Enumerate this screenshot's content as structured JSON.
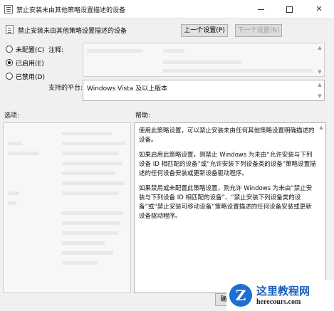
{
  "window": {
    "title": "禁止安装未由其他策略设置描述的设备",
    "minimize_icon": "minimize-icon",
    "maximize_icon": "maximize-icon",
    "close_icon": "close-icon",
    "close_glyph": "✕"
  },
  "header": {
    "policy_title": "禁止安装未由其他策略设置描述的设备",
    "prev_button": "上一个设置(P)",
    "next_button": "下一个设置(N)"
  },
  "state_options": [
    {
      "label": "未配置(C)",
      "checked": false
    },
    {
      "label": "已启用(E)",
      "checked": true
    },
    {
      "label": "已禁用(D)",
      "checked": false
    }
  ],
  "labels": {
    "comment": "注释:",
    "supported_on": "支持的平台:",
    "options": "选项:",
    "help": "帮助:"
  },
  "supported_platform": "Windows Vista 及以上版本",
  "help_paragraphs": [
    "使用此策略设置，可以禁止安装未由任何其他策略设置明确描述的设备。",
    "如果启用此策略设置，则禁止 Windows 为未由“允许安装与下列设备 ID 相匹配的设备”或“允许安装下列设备类的设备”策略设置描述的任何设备安装或更新设备驱动程序。",
    "如果禁用或未配置此策略设置，则允许 Windows 为未由“禁止安装与下列设备 ID 相匹配的设备”、“禁止安装下列设备类的设备”或“禁止安装可移动设备”策略设置描述的任何设备安装或更新设备驱动程序。"
  ],
  "footer": {
    "ok_button": "确"
  },
  "watermark": {
    "logo_letter": "Z",
    "site_name": "这里教程网",
    "site_url": "herecours.com"
  },
  "colors": {
    "window_bg": "#f0f0f0",
    "button_bg": "#e1e1e1",
    "watermark_blue": "#1b5fbf"
  }
}
